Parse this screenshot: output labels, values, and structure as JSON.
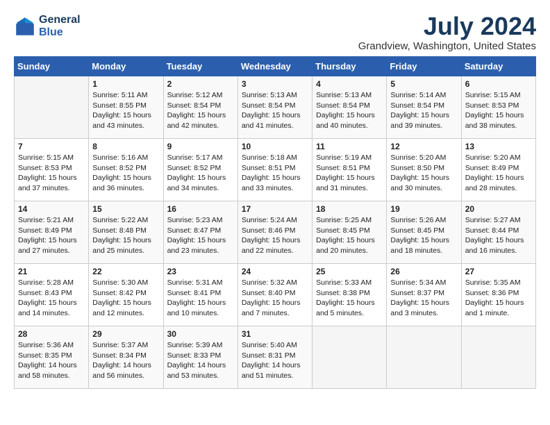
{
  "header": {
    "logo_line1": "General",
    "logo_line2": "Blue",
    "month_title": "July 2024",
    "location": "Grandview, Washington, United States"
  },
  "calendar": {
    "days_of_week": [
      "Sunday",
      "Monday",
      "Tuesday",
      "Wednesday",
      "Thursday",
      "Friday",
      "Saturday"
    ],
    "weeks": [
      [
        {
          "day": "",
          "content": ""
        },
        {
          "day": "1",
          "content": "Sunrise: 5:11 AM\nSunset: 8:55 PM\nDaylight: 15 hours\nand 43 minutes."
        },
        {
          "day": "2",
          "content": "Sunrise: 5:12 AM\nSunset: 8:54 PM\nDaylight: 15 hours\nand 42 minutes."
        },
        {
          "day": "3",
          "content": "Sunrise: 5:13 AM\nSunset: 8:54 PM\nDaylight: 15 hours\nand 41 minutes."
        },
        {
          "day": "4",
          "content": "Sunrise: 5:13 AM\nSunset: 8:54 PM\nDaylight: 15 hours\nand 40 minutes."
        },
        {
          "day": "5",
          "content": "Sunrise: 5:14 AM\nSunset: 8:54 PM\nDaylight: 15 hours\nand 39 minutes."
        },
        {
          "day": "6",
          "content": "Sunrise: 5:15 AM\nSunset: 8:53 PM\nDaylight: 15 hours\nand 38 minutes."
        }
      ],
      [
        {
          "day": "7",
          "content": "Sunrise: 5:15 AM\nSunset: 8:53 PM\nDaylight: 15 hours\nand 37 minutes."
        },
        {
          "day": "8",
          "content": "Sunrise: 5:16 AM\nSunset: 8:52 PM\nDaylight: 15 hours\nand 36 minutes."
        },
        {
          "day": "9",
          "content": "Sunrise: 5:17 AM\nSunset: 8:52 PM\nDaylight: 15 hours\nand 34 minutes."
        },
        {
          "day": "10",
          "content": "Sunrise: 5:18 AM\nSunset: 8:51 PM\nDaylight: 15 hours\nand 33 minutes."
        },
        {
          "day": "11",
          "content": "Sunrise: 5:19 AM\nSunset: 8:51 PM\nDaylight: 15 hours\nand 31 minutes."
        },
        {
          "day": "12",
          "content": "Sunrise: 5:20 AM\nSunset: 8:50 PM\nDaylight: 15 hours\nand 30 minutes."
        },
        {
          "day": "13",
          "content": "Sunrise: 5:20 AM\nSunset: 8:49 PM\nDaylight: 15 hours\nand 28 minutes."
        }
      ],
      [
        {
          "day": "14",
          "content": "Sunrise: 5:21 AM\nSunset: 8:49 PM\nDaylight: 15 hours\nand 27 minutes."
        },
        {
          "day": "15",
          "content": "Sunrise: 5:22 AM\nSunset: 8:48 PM\nDaylight: 15 hours\nand 25 minutes."
        },
        {
          "day": "16",
          "content": "Sunrise: 5:23 AM\nSunset: 8:47 PM\nDaylight: 15 hours\nand 23 minutes."
        },
        {
          "day": "17",
          "content": "Sunrise: 5:24 AM\nSunset: 8:46 PM\nDaylight: 15 hours\nand 22 minutes."
        },
        {
          "day": "18",
          "content": "Sunrise: 5:25 AM\nSunset: 8:45 PM\nDaylight: 15 hours\nand 20 minutes."
        },
        {
          "day": "19",
          "content": "Sunrise: 5:26 AM\nSunset: 8:45 PM\nDaylight: 15 hours\nand 18 minutes."
        },
        {
          "day": "20",
          "content": "Sunrise: 5:27 AM\nSunset: 8:44 PM\nDaylight: 15 hours\nand 16 minutes."
        }
      ],
      [
        {
          "day": "21",
          "content": "Sunrise: 5:28 AM\nSunset: 8:43 PM\nDaylight: 15 hours\nand 14 minutes."
        },
        {
          "day": "22",
          "content": "Sunrise: 5:30 AM\nSunset: 8:42 PM\nDaylight: 15 hours\nand 12 minutes."
        },
        {
          "day": "23",
          "content": "Sunrise: 5:31 AM\nSunset: 8:41 PM\nDaylight: 15 hours\nand 10 minutes."
        },
        {
          "day": "24",
          "content": "Sunrise: 5:32 AM\nSunset: 8:40 PM\nDaylight: 15 hours\nand 7 minutes."
        },
        {
          "day": "25",
          "content": "Sunrise: 5:33 AM\nSunset: 8:38 PM\nDaylight: 15 hours\nand 5 minutes."
        },
        {
          "day": "26",
          "content": "Sunrise: 5:34 AM\nSunset: 8:37 PM\nDaylight: 15 hours\nand 3 minutes."
        },
        {
          "day": "27",
          "content": "Sunrise: 5:35 AM\nSunset: 8:36 PM\nDaylight: 15 hours\nand 1 minute."
        }
      ],
      [
        {
          "day": "28",
          "content": "Sunrise: 5:36 AM\nSunset: 8:35 PM\nDaylight: 14 hours\nand 58 minutes."
        },
        {
          "day": "29",
          "content": "Sunrise: 5:37 AM\nSunset: 8:34 PM\nDaylight: 14 hours\nand 56 minutes."
        },
        {
          "day": "30",
          "content": "Sunrise: 5:39 AM\nSunset: 8:33 PM\nDaylight: 14 hours\nand 53 minutes."
        },
        {
          "day": "31",
          "content": "Sunrise: 5:40 AM\nSunset: 8:31 PM\nDaylight: 14 hours\nand 51 minutes."
        },
        {
          "day": "",
          "content": ""
        },
        {
          "day": "",
          "content": ""
        },
        {
          "day": "",
          "content": ""
        }
      ]
    ]
  }
}
